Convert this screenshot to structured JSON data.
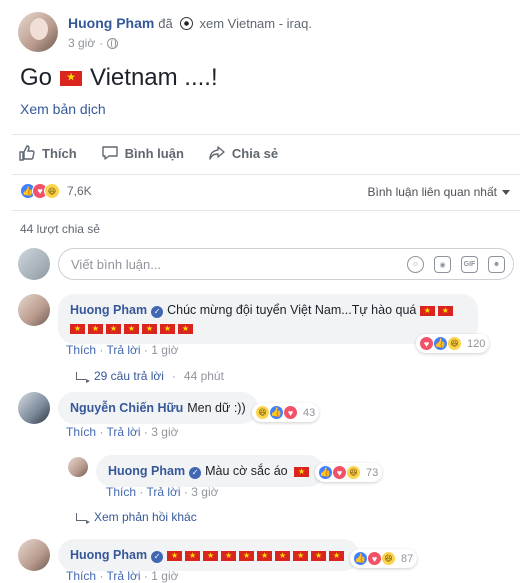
{
  "post": {
    "author": "Huong Pham",
    "activity_prefix": "đã",
    "activity_icon": "soccer-ball-icon",
    "activity_text": "xem Vietnam - iraq.",
    "time": "3 giờ",
    "privacy_icon": "globe-icon",
    "status_prefix": "Go",
    "status_suffix": "Vietnam ....!",
    "translate_link": "Xem bản dịch"
  },
  "actions": {
    "like": "Thích",
    "comment": "Bình luận",
    "share": "Chia sẻ"
  },
  "summary": {
    "reactions_count": "7,6K",
    "reaction_types": [
      "like",
      "love",
      "haha"
    ],
    "sort_label": "Bình luận liên quan nhất",
    "shares": "44 lượt chia sẻ"
  },
  "composer": {
    "placeholder": "Viết bình luận...",
    "tools": [
      "emoji-icon",
      "camera-icon",
      "gif-icon",
      "sticker-icon"
    ]
  },
  "comments": [
    {
      "author": "Huong Pham",
      "verified": true,
      "text": "Chúc mừng đội tuyển Việt Nam...Tự hào quá",
      "flag_count_line1": 2,
      "flag_count_line2": 7,
      "actions": {
        "like": "Thích",
        "reply": "Trả lời",
        "time": "1 giờ"
      },
      "reactions": [
        "love",
        "like",
        "haha"
      ],
      "reaction_count": "120",
      "replies_link": "29 câu trả lời",
      "replies_time": "44 phút"
    },
    {
      "author": "Nguyễn Chiến Hữu",
      "verified": false,
      "text": "Men dữ :))",
      "actions": {
        "like": "Thích",
        "reply": "Trả lời",
        "time": "3 giờ"
      },
      "reactions": [
        "haha",
        "like",
        "love"
      ],
      "reaction_count": "43"
    },
    {
      "author": "Huong Pham",
      "verified": true,
      "text": "Màu cờ sắc áo",
      "flag_count": 1,
      "actions": {
        "like": "Thích",
        "reply": "Trả lời",
        "time": "3 giờ"
      },
      "reactions": [
        "like",
        "love",
        "haha"
      ],
      "reaction_count": "73",
      "more_replies": "Xem phản hồi khác"
    },
    {
      "author": "Huong Pham",
      "verified": true,
      "flag_count": 10,
      "actions": {
        "like": "Thích",
        "reply": "Trả lời",
        "time": "1 giờ"
      },
      "reactions": [
        "like",
        "love",
        "haha"
      ],
      "reaction_count": "87"
    }
  ],
  "colors": {
    "link_blue": "#365899",
    "flag_red": "#da251d",
    "flag_star": "#ffde00",
    "like_blue": "#4080ff",
    "love_red": "#f25268",
    "haha_yellow": "#fbd44c"
  }
}
